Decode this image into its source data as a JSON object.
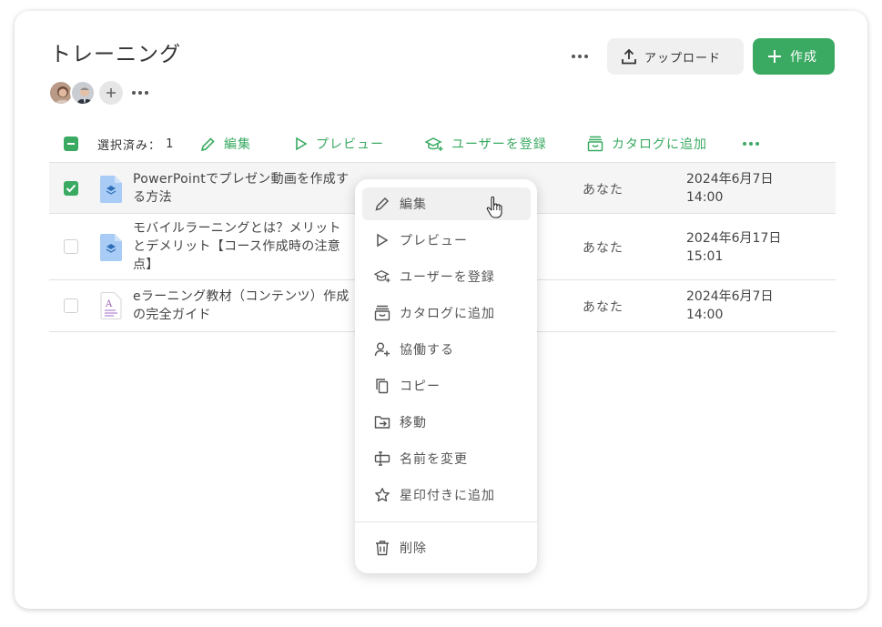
{
  "page": {
    "title": "トレーニング"
  },
  "header": {
    "upload_label": "アップロード",
    "create_label": "作成"
  },
  "toolbar": {
    "selected_label": "選択済み：",
    "selected_count": "1",
    "edit_label": "編集",
    "preview_label": "プレビュー",
    "enroll_label": "ユーザーを登録",
    "catalog_label": "カタログに追加"
  },
  "files": [
    {
      "name": "PowerPointでプレゼン動画を作成する方法",
      "owner": "あなた",
      "date": "2024年6月7日 14:00",
      "checked": true,
      "icon": "layers-file-icon"
    },
    {
      "name": "モバイルラーニングとは？メリットとデメリット【コース作成時の注意点】",
      "owner": "あなた",
      "date": "2024年6月17日 15:01",
      "checked": false,
      "icon": "layers-file-icon"
    },
    {
      "name": "eラーニング教材（コンテンツ）作成の完全ガイド",
      "owner": "あなた",
      "date": "2024年6月7日 14:00",
      "checked": false,
      "icon": "document-file-icon"
    }
  ],
  "context_menu": {
    "items": [
      {
        "label": "編集",
        "icon": "pencil-icon"
      },
      {
        "label": "プレビュー",
        "icon": "play-icon"
      },
      {
        "label": "ユーザーを登録",
        "icon": "graduation-cap-icon"
      },
      {
        "label": "カタログに追加",
        "icon": "catalog-icon"
      },
      {
        "label": "協働する",
        "icon": "add-person-icon"
      },
      {
        "label": "コピー",
        "icon": "copy-icon"
      },
      {
        "label": "移動",
        "icon": "move-folder-icon"
      },
      {
        "label": "名前を変更",
        "icon": "rename-icon"
      },
      {
        "label": "星印付きに追加",
        "icon": "star-icon"
      },
      {
        "label": "削除",
        "icon": "trash-icon"
      }
    ]
  },
  "colors": {
    "accent": "#3aaa62",
    "file_blue": "#a8ccf5",
    "doc_purple": "#9b59b6"
  }
}
